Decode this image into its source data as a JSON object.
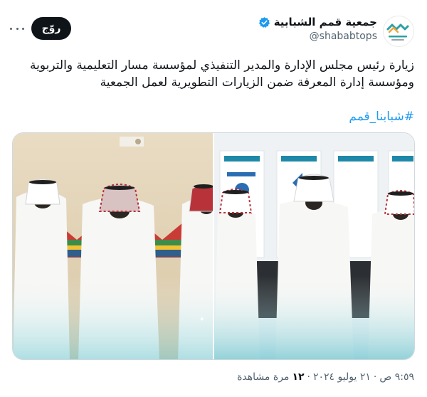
{
  "author": {
    "display_name": "جمعية قمم الشبابية",
    "handle": "@shababtops",
    "verified": true,
    "avatar_icon": "qimam-logo-icon",
    "brand_color": "#2aa0a6"
  },
  "actions": {
    "follow_label": "روّج",
    "more_icon": "more-icon"
  },
  "tweet": {
    "text": "زيارة رئيس مجلس الإدارة والمدير التنفيذي لمؤسسة مسار التعليمية والتربوية ومؤسسة إدارة المعرفة ضمن الزيارات التطويرية لعمل الجمعية",
    "hashtag": "#شبابنا_قمم"
  },
  "media": {
    "photo_count": 2
  },
  "meta": {
    "time": "٩:٥٩ ص",
    "date": "٢١ يوليو ٢٠٢٤",
    "views_count": "١٢",
    "views_label": "مرة مشاهدة",
    "separator": "·"
  }
}
